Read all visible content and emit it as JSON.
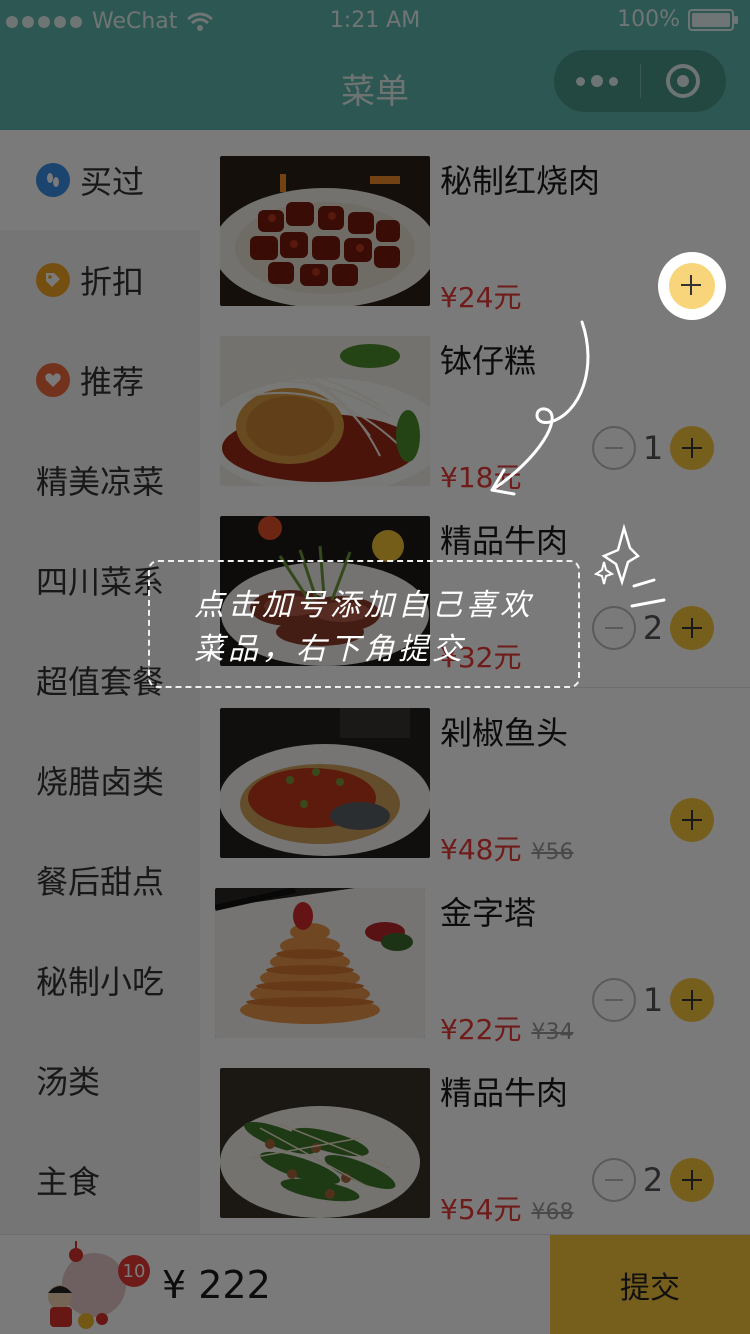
{
  "status_bar": {
    "carrier": "WeChat",
    "time": "1:21 AM",
    "battery": "100%"
  },
  "navbar": {
    "title": "菜单"
  },
  "sidebar": {
    "items": [
      {
        "label": "买过",
        "icon": "footprint-icon",
        "color": "#3a8ee6"
      },
      {
        "label": "折扣",
        "icon": "tag-icon",
        "color": "#f5a623"
      },
      {
        "label": "推荐",
        "icon": "heart-icon",
        "color": "#f06a3c"
      },
      {
        "label": "精美凉菜"
      },
      {
        "label": "四川菜系"
      },
      {
        "label": "超值套餐"
      },
      {
        "label": "烧腊卤类"
      },
      {
        "label": "餐后甜点"
      },
      {
        "label": "秘制小吃"
      },
      {
        "label": "汤类"
      },
      {
        "label": "主食"
      }
    ]
  },
  "dishes": [
    {
      "name": "秘制红烧肉",
      "price": "¥24元",
      "old_price": "",
      "qty": ""
    },
    {
      "name": "钵仔糕",
      "price": "¥18元",
      "old_price": "",
      "qty": "1"
    },
    {
      "name": "精品牛肉",
      "price": "¥32元",
      "old_price": "",
      "qty": "2"
    },
    {
      "name": "剁椒鱼头",
      "price": "¥48元",
      "old_price": "¥56",
      "qty": ""
    },
    {
      "name": "金字塔",
      "price": "¥22元",
      "old_price": "¥34",
      "qty": "1"
    },
    {
      "name": "精品牛肉",
      "price": "¥54元",
      "old_price": "¥68",
      "qty": "2"
    }
  ],
  "cart": {
    "badge": "10",
    "total": "¥ 222",
    "submit_label": "提交"
  },
  "tip": {
    "line1": "点击加号添加自己喜欢",
    "line2": "菜品，右下角提交"
  },
  "colors": {
    "theme": "#5fb7ab",
    "accent": "#f7c63c",
    "price": "#e53935"
  }
}
